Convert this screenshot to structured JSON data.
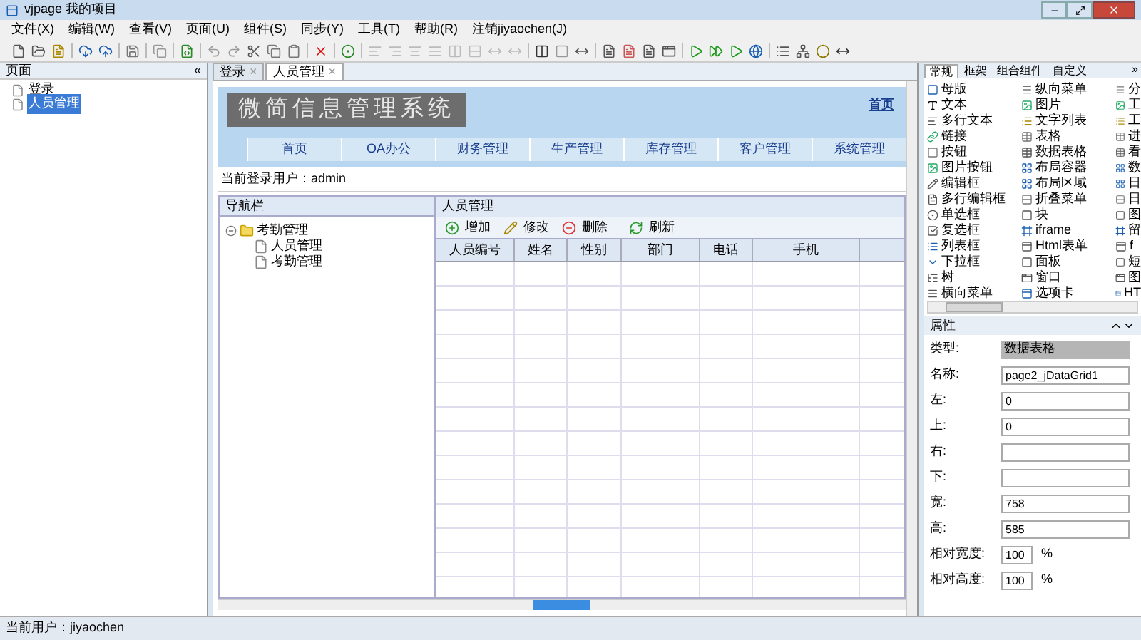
{
  "window": {
    "title": "vjpage 我的项目"
  },
  "menu": [
    "文件(X)",
    "编辑(W)",
    "查看(V)",
    "页面(U)",
    "组件(S)",
    "同步(Y)",
    "工具(T)",
    "帮助(R)",
    "注销jiyaochen(J)"
  ],
  "pages_panel": {
    "title": "页面",
    "collapse": "«",
    "items": [
      {
        "label": "登录",
        "selected": false
      },
      {
        "label": "人员管理",
        "selected": true
      }
    ]
  },
  "doc_tabs": [
    {
      "label": "登录",
      "close": "×",
      "selected": false
    },
    {
      "label": "人员管理",
      "close": "×",
      "selected": true
    }
  ],
  "page": {
    "banner_title": "微简信息管理系统",
    "home_link": "首页",
    "nav": [
      "首页",
      "OA办公",
      "财务管理",
      "生产管理",
      "库存管理",
      "客户管理",
      "系统管理"
    ],
    "user_line": "当前登录用户：admin",
    "nav_panel": {
      "title": "导航栏",
      "tree": [
        {
          "label": "考勤管理",
          "expanded": true,
          "children": [
            {
              "label": "人员管理"
            },
            {
              "label": "考勤管理"
            }
          ]
        }
      ]
    },
    "grid_panel": {
      "title": "人员管理",
      "actions": [
        {
          "label": "增加",
          "kind": "add"
        },
        {
          "label": "修改",
          "kind": "edit"
        },
        {
          "label": "删除",
          "kind": "delete"
        },
        {
          "label": "刷新",
          "kind": "refresh"
        }
      ],
      "columns": [
        "人员编号",
        "姓名",
        "性别",
        "部门",
        "电话",
        "手机"
      ]
    }
  },
  "palette": {
    "tabs": [
      {
        "label": "常规",
        "selected": true
      },
      {
        "label": "框架",
        "selected": false
      },
      {
        "label": "组合组件",
        "selected": false
      },
      {
        "label": "自定义",
        "selected": false
      }
    ],
    "more": "»",
    "columns": [
      [
        "母版",
        "文本",
        "多行文本",
        "链接",
        "按钮",
        "图片按钮",
        "编辑框",
        "多行编辑框",
        "单选框",
        "复选框",
        "列表框",
        "下拉框",
        "树",
        "横向菜单"
      ],
      [
        "纵向菜单",
        "图片",
        "文字列表",
        "表格",
        "数据表格",
        "布局容器",
        "布局区域",
        "折叠菜单",
        "块",
        "iframe",
        "Html表单",
        "面板",
        "窗口",
        "选项卡"
      ],
      [
        "分",
        "工",
        "工",
        "进",
        "看",
        "数",
        "日",
        "日",
        "图",
        "留",
        "f",
        "短",
        "图",
        "HT"
      ]
    ]
  },
  "properties": {
    "title": "属性",
    "rows": [
      {
        "label": "类型:",
        "value": "数据表格",
        "kind": "readonly"
      },
      {
        "label": "名称:",
        "value": "page2_jDataGrid1",
        "kind": "text"
      },
      {
        "label": "左:",
        "value": "0",
        "kind": "text"
      },
      {
        "label": "上:",
        "value": "0",
        "kind": "text"
      },
      {
        "label": "右:",
        "kind": "text"
      },
      {
        "label": "下:",
        "kind": "text"
      },
      {
        "label": "宽:",
        "value": "758",
        "kind": "text"
      },
      {
        "label": "高:",
        "value": "585",
        "kind": "text"
      },
      {
        "label": "相对宽度:",
        "value": "100",
        "unit": "%",
        "kind": "percent"
      },
      {
        "label": "相对高度:",
        "value": "100",
        "unit": "%",
        "kind": "percent"
      }
    ]
  },
  "status_bar": "当前用户：jiyaochen"
}
